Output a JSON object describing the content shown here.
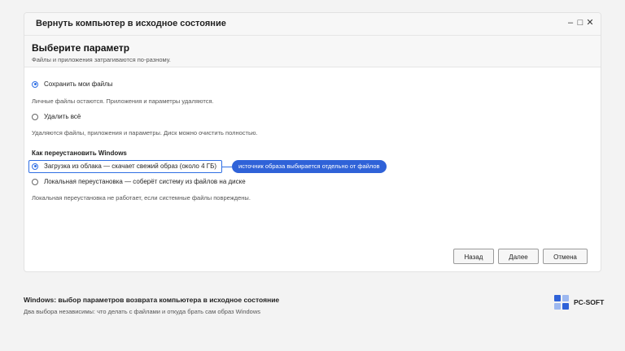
{
  "window": {
    "title": "Вернуть компьютер в исходное состояние",
    "controls": [
      "–",
      "□",
      "✕"
    ]
  },
  "header": {
    "title": "Выберите параметр",
    "subtitle": "Файлы и приложения затрагиваются по-разному."
  },
  "files_options": [
    {
      "label": "Сохранить мои файлы",
      "selected": true,
      "description": "Личные файлы остаются. Приложения и параметры удаляются."
    },
    {
      "label": "Удалить всё",
      "selected": false,
      "description": "Удаляются файлы, приложения и параметры. Диск можно очистить полностью."
    }
  ],
  "reinstall": {
    "heading": "Как переустановить Windows",
    "options": [
      {
        "label": "Загрузка из облака — скачает свежий образ (около 4 ГБ)",
        "selected": true
      },
      {
        "label": "Локальная переустановка — соберёт систему из файлов на диске",
        "selected": false
      }
    ],
    "note": "Локальная переустановка не работает, если системные файлы повреждены."
  },
  "callout": "источник образа выбирается отдельно от файлов",
  "buttons": {
    "back": "Назад",
    "next": "Далее",
    "cancel": "Отмена"
  },
  "footer": {
    "title": "Windows: выбор параметров возврата компьютера в исходное состояние",
    "subtitle": "Два выбора независимы: что делать с файлами и откуда брать сам образ Windows",
    "brand": "PC-SOFT"
  },
  "colors": {
    "accent": "#2f6fe4",
    "callout_bg": "#2f62d8",
    "logo_squares": [
      "#2f62d8",
      "#9db8f0",
      "#9db8f0",
      "#2f62d8"
    ]
  }
}
